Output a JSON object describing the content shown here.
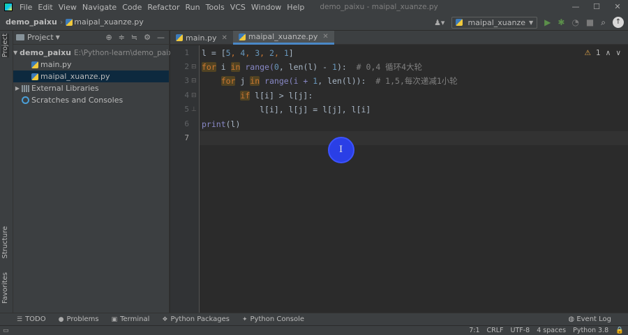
{
  "menubar": {
    "items": [
      {
        "label": "File"
      },
      {
        "label": "Edit"
      },
      {
        "label": "View"
      },
      {
        "label": "Navigate"
      },
      {
        "label": "Code"
      },
      {
        "label": "Refactor"
      },
      {
        "label": "Run"
      },
      {
        "label": "Tools"
      },
      {
        "label": "VCS"
      },
      {
        "label": "Window"
      },
      {
        "label": "Help"
      }
    ],
    "window_title": "demo_paixu - maipal_xuanze.py",
    "controls": {
      "minimize": "—",
      "maximize": "☐",
      "close": "✕"
    }
  },
  "navbar": {
    "project": "demo_paixu",
    "file": "maipal_xuanze.py",
    "run_config": "maipal_xuanze"
  },
  "strip": {
    "project": "Project",
    "structure": "Structure",
    "favorites": "Favorites"
  },
  "project_panel": {
    "title": "Project",
    "tree": {
      "root": {
        "label": "demo_paixu",
        "path": "E:\\Python-learn\\demo_paixu"
      },
      "file1": "main.py",
      "file2": "maipal_xuanze.py",
      "libs": "External Libraries",
      "scratches": "Scratches and Consoles"
    }
  },
  "editor": {
    "tabs": [
      {
        "label": "main.py"
      },
      {
        "label": "maipal_xuanze.py"
      }
    ],
    "inspection": "1",
    "line_numbers": [
      "1",
      "2",
      "3",
      "4",
      "5",
      "6",
      "7"
    ],
    "code": {
      "l1_a": "l = [",
      "l1_nums": [
        "5",
        "4",
        "3",
        "2",
        "1"
      ],
      "l1_end": "]",
      "l2_for": "for",
      "l2_i": " i ",
      "l2_in": "in",
      "l2_range": " range(",
      "l2_zero": "0",
      "l2_mid": ", len(l) - ",
      "l2_one": "1",
      "l2_end": "):  ",
      "l2_comment": "# 0,4 循环4大轮",
      "l3_for": "for",
      "l3_j": " j ",
      "l3_in": "in",
      "l3_range": " range(i + ",
      "l3_one": "1",
      "l3_end": ", len(l)):  ",
      "l3_comment": "# 1,5,每次递减1小轮",
      "l4_if": "if",
      "l4_rest": " l[i] > l[j]:",
      "l5": "l[i], l[j] = l[j], l[i]",
      "l6_print": "print",
      "l6_rest": "(l)"
    }
  },
  "bottom_tools": {
    "items": [
      {
        "label": "TODO"
      },
      {
        "label": "Problems"
      },
      {
        "label": "Terminal"
      },
      {
        "label": "Python Packages"
      },
      {
        "label": "Python Console"
      }
    ],
    "event_log": "Event Log"
  },
  "status": {
    "position": "7:1",
    "line_sep": "CRLF",
    "encoding": "UTF-8",
    "indent": "4 spaces",
    "interpreter": "Python 3.8"
  },
  "colors": {
    "background": "#2b2b2b",
    "panel": "#3c3f41",
    "keyword": "#cc7832",
    "number": "#6897bb",
    "comment": "#808080",
    "cursor_highlight": "#2a3fe6"
  }
}
